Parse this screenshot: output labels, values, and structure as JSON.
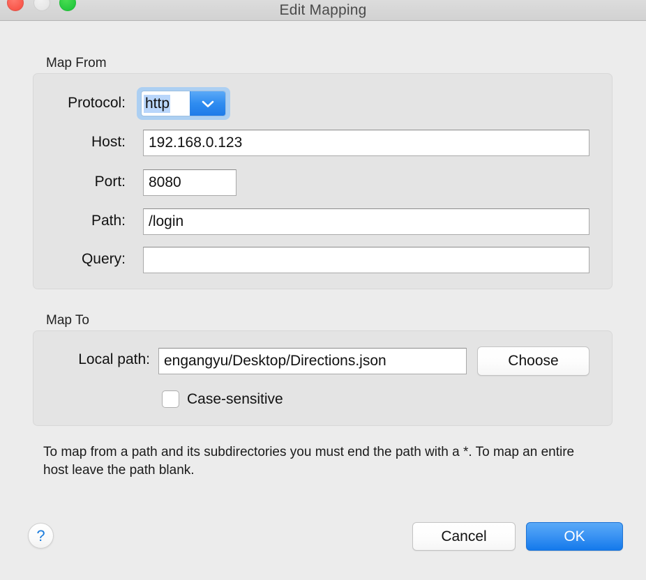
{
  "window": {
    "title": "Edit Mapping",
    "traffic_lights": {
      "close": "close-button",
      "minimize": "minimize-button",
      "zoom": "zoom-button"
    }
  },
  "map_from": {
    "section_title": "Map From",
    "fields": [
      {
        "label": "Protocol:",
        "value": "http",
        "type": "combobox",
        "selected_text": "http"
      },
      {
        "label": "Host:",
        "value": "192.168.0.123",
        "type": "text"
      },
      {
        "label": "Port:",
        "value": "8080",
        "type": "text"
      },
      {
        "label": "Path:",
        "value": "/login",
        "type": "text"
      },
      {
        "label": "Query:",
        "value": "",
        "type": "text"
      }
    ]
  },
  "map_to": {
    "section_title": "Map To",
    "local_path_label": "Local path:",
    "local_path_value": "engangyu/Desktop/Directions.json",
    "choose_button": "Choose",
    "case_sensitive_label": "Case-sensitive",
    "case_sensitive_checked": false
  },
  "help_text": "To map from a path and its subdirectories you must end the path with a *. To map an entire host leave the path blank.",
  "footer": {
    "help_glyph": "?",
    "cancel_label": "Cancel",
    "ok_label": "OK"
  },
  "colors": {
    "accent_blue": "#1479eb",
    "window_background": "#ececec",
    "group_background": "#e4e4e4",
    "selection_blue": "#b9d6fb",
    "close_red": "#f9584c",
    "zoom_green": "#27c93f"
  }
}
